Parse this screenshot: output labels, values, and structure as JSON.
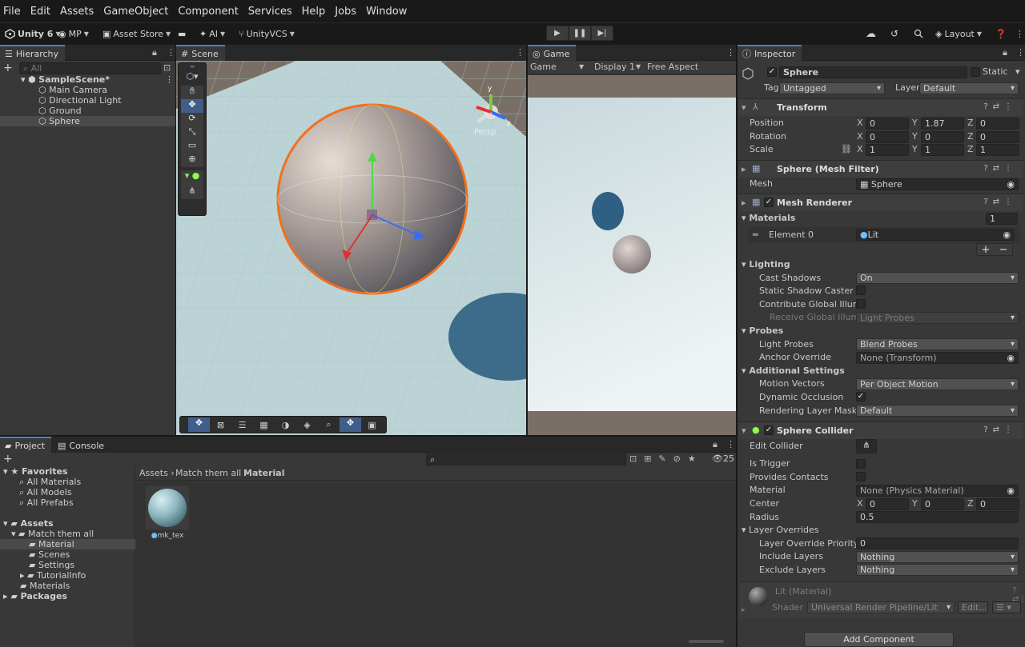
{
  "menu": [
    "File",
    "Edit",
    "Assets",
    "GameObject",
    "Component",
    "Services",
    "Help",
    "Jobs",
    "Window"
  ],
  "toolbar": {
    "unity": "Unity 6",
    "account": "MP",
    "asset_store": "Asset Store",
    "ai": "AI",
    "vcs": "UnityVCS",
    "layout": "Layout"
  },
  "hierarchy": {
    "tab": "Hierarchy",
    "search_placeholder": "All",
    "scene": "SampleScene*",
    "items": [
      "Main Camera",
      "Directional Light",
      "Ground",
      "Sphere"
    ]
  },
  "scene": {
    "tab": "Scene",
    "persp": "Persp"
  },
  "game": {
    "tab": "Game",
    "mode": "Game",
    "display": "Display 1",
    "aspect": "Free Aspect"
  },
  "project": {
    "tabs": [
      "Project",
      "Console"
    ],
    "count": "25",
    "favorites": {
      "label": "Favorites",
      "items": [
        "All Materials",
        "All Models",
        "All Prefabs"
      ]
    },
    "assets": {
      "label": "Assets",
      "match": "Match them all",
      "sub": [
        "Material",
        "Scenes",
        "Settings",
        "TutorialInfo"
      ],
      "materials": "Materials"
    },
    "packages": "Packages",
    "breadcrumb": [
      "Assets",
      "Match them all",
      "Material"
    ],
    "file": "mk_tex"
  },
  "inspector": {
    "tab": "Inspector",
    "name": "Sphere",
    "static": "Static",
    "tag_label": "Tag",
    "tag": "Untagged",
    "layer_label": "Layer",
    "layer": "Default",
    "transform": {
      "title": "Transform",
      "position_label": "Position",
      "position": [
        "0",
        "1.87",
        "0"
      ],
      "rotation_label": "Rotation",
      "rotation": [
        "0",
        "0",
        "0"
      ],
      "scale_label": "Scale",
      "scale": [
        "1",
        "1",
        "1"
      ]
    },
    "mesh_filter": {
      "title": "Sphere (Mesh Filter)",
      "mesh_label": "Mesh",
      "mesh": "Sphere"
    },
    "mesh_renderer": {
      "title": "Mesh Renderer",
      "materials_label": "Materials",
      "materials_count": "1",
      "element0_label": "Element 0",
      "element0": "Lit",
      "lighting": "Lighting",
      "cast_shadows_label": "Cast Shadows",
      "cast_shadows": "On",
      "static_shadow_label": "Static Shadow Caster",
      "contribute_gi_label": "Contribute Global Illumina",
      "receive_gi_label": "Receive Global Illumina",
      "receive_gi": "Light Probes",
      "probes": "Probes",
      "light_probes_label": "Light Probes",
      "light_probes": "Blend Probes",
      "anchor_label": "Anchor Override",
      "anchor": "None (Transform)",
      "additional": "Additional Settings",
      "motion_label": "Motion Vectors",
      "motion": "Per Object Motion",
      "dynamic_label": "Dynamic Occlusion",
      "rendering_label": "Rendering Layer Mask",
      "rendering": "Default"
    },
    "sphere_collider": {
      "title": "Sphere Collider",
      "edit_label": "Edit Collider",
      "trigger_label": "Is Trigger",
      "contacts_label": "Provides Contacts",
      "material_label": "Material",
      "material": "None (Physics Material)",
      "center_label": "Center",
      "center": [
        "0",
        "0",
        "0"
      ],
      "radius_label": "Radius",
      "radius": "0.5",
      "layer_overrides": "Layer Overrides",
      "priority_label": "Layer Override Priority",
      "priority": "0",
      "include_label": "Include Layers",
      "include": "Nothing",
      "exclude_label": "Exclude Layers",
      "exclude": "Nothing"
    },
    "material": {
      "title": "Lit (Material)",
      "shader_label": "Shader",
      "shader": "Universal Render Pipeline/Lit",
      "edit": "Edit..."
    },
    "add_component": "Add Component"
  },
  "colors": {
    "accent": "#4d80c8",
    "selection_orange": "#f07020",
    "panel": "#383838",
    "dark": "#282828"
  }
}
